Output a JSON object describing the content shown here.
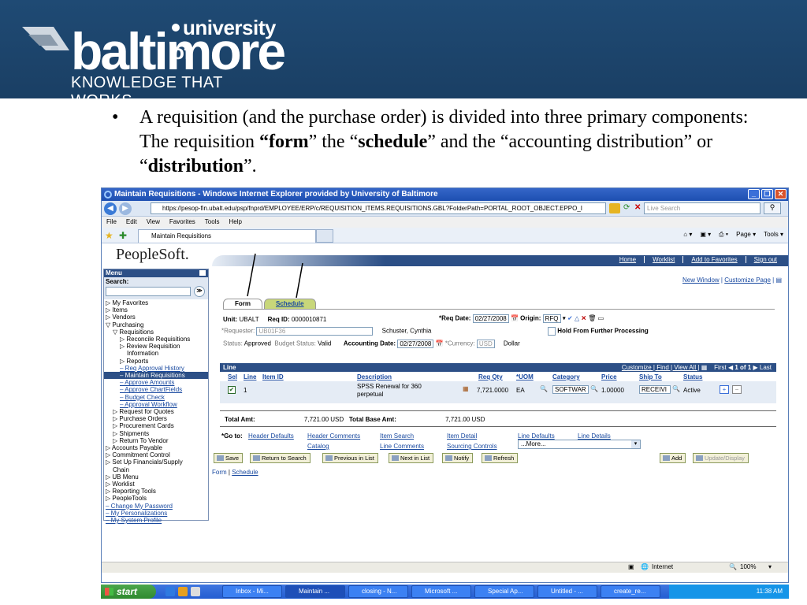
{
  "slide": {
    "logo": {
      "top": "university of",
      "main": "baltimore",
      "tagline": "KNOWLEDGE THAT WORKS"
    },
    "bullet": {
      "part1": "A requisition (and the purchase order) is divided into three primary components:  The requisition ",
      "form": "“form",
      "part2": "” the “",
      "schedule": "schedule",
      "part3": "” and the “accounting distribution” or “",
      "distribution": "distribution",
      "part4": "”."
    }
  },
  "browser": {
    "title": "Maintain Requisitions - Windows Internet Explorer provided by University of Baltimore",
    "url": "https://pesop-fin.ubalt.edu/psp/fnprd/EMPLOYEE/ERP/c/REQUISITION_ITEMS.REQUISITIONS.GBL?FolderPath=PORTAL_ROOT_OBJECT.EPPO_I",
    "search_placeholder": "Live Search",
    "menu": [
      "File",
      "Edit",
      "View",
      "Favorites",
      "Tools",
      "Help"
    ],
    "tab_label": "Maintain Requisitions",
    "commands": [
      "Page ▾",
      "Tools ▾"
    ],
    "status_zone": "Internet",
    "zoom": "100%"
  },
  "ps": {
    "logo": "PeopleSoft.",
    "links": [
      "Home",
      "Worklist",
      "Add to Favorites",
      "Sign out"
    ],
    "new_window": "New Window",
    "customize_page": "Customize Page",
    "menu_title": "Menu",
    "search_label": "Search:",
    "menu_items": [
      {
        "t": "▷ My Favorites",
        "i": 0
      },
      {
        "t": "▷ Items",
        "i": 0
      },
      {
        "t": "▷ Vendors",
        "i": 0
      },
      {
        "t": "▽ Purchasing",
        "i": 0
      },
      {
        "t": "▽ Requisitions",
        "i": 1
      },
      {
        "t": "▷ Reconcile Requisitions",
        "i": 2
      },
      {
        "t": "▷ Review Requisition",
        "i": 2
      },
      {
        "t": "Information",
        "i": 3
      },
      {
        "t": "▷ Reports",
        "i": 2
      },
      {
        "t": "– Req Approval History",
        "i": 2,
        "link": true
      },
      {
        "t": "– Maintain Requisitions",
        "i": 2,
        "sel": true
      },
      {
        "t": "– Approve Amounts",
        "i": 2,
        "link": true
      },
      {
        "t": "– Approve ChartFields",
        "i": 2,
        "link": true
      },
      {
        "t": "– Budget Check",
        "i": 2,
        "link": true
      },
      {
        "t": "– Approval Workflow",
        "i": 2,
        "link": true
      },
      {
        "t": "▷ Request for Quotes",
        "i": 1
      },
      {
        "t": "▷ Purchase Orders",
        "i": 1
      },
      {
        "t": "▷ Procurement Cards",
        "i": 1
      },
      {
        "t": "▷ Shipments",
        "i": 1
      },
      {
        "t": "▷ Return To Vendor",
        "i": 1
      },
      {
        "t": "▷ Accounts Payable",
        "i": 0
      },
      {
        "t": "▷ Commitment Control",
        "i": 0
      },
      {
        "t": "▷ Set Up Financials/Supply",
        "i": 0
      },
      {
        "t": "Chain",
        "i": 1
      },
      {
        "t": "▷ UB Menu",
        "i": 0
      },
      {
        "t": "▷ Worklist",
        "i": 0
      },
      {
        "t": "▷ Reporting Tools",
        "i": 0
      },
      {
        "t": "▷ PeopleTools",
        "i": 0
      },
      {
        "t": "– Change My Password",
        "i": 0,
        "link": true
      },
      {
        "t": "– My Personalizations",
        "i": 0,
        "link": true
      },
      {
        "t": "– My System Profile",
        "i": 0,
        "link": true
      }
    ],
    "tabs": {
      "form": "Form",
      "schedule": "Schedule"
    },
    "header": {
      "unit_label": "Unit:",
      "unit": "UBALT",
      "reqid_label": "Req ID:",
      "reqid": "0000010871",
      "reqdate_label": "*Req Date:",
      "reqdate": "02/27/2008",
      "origin_label": "Origin:",
      "origin": "RFQ",
      "requester_label": "*Requester:",
      "requester": "UB01F36",
      "requester_name": "Schuster, Cynthia",
      "hold_label": "Hold From Further Processing",
      "status_label": "Status:",
      "status": "Approved",
      "budget_label": "Budget Status:",
      "budget": "Valid",
      "acctdate_label": "Accounting Date:",
      "acctdate": "02/27/2008",
      "currency_label": "*Currency:",
      "currency": "USD",
      "currency_desc": "Dollar"
    },
    "grid": {
      "title": "Line",
      "nav": "Customize | Find | View All |",
      "pager": "First",
      "pager_count": "1 of 1",
      "pager_last": "Last",
      "columns": [
        "Sel",
        "Line",
        "Item ID",
        "Description",
        "Req Qty",
        "*UOM",
        "Category",
        "Price",
        "Ship To",
        "Status"
      ],
      "row": {
        "line": "1",
        "desc1": "SPSS Renewal for 360",
        "desc2": "perpetual",
        "qty": "7,721.0000",
        "uom": "EA",
        "category": "SOFTWAR",
        "price": "1.00000",
        "shipto": "RECEIVI",
        "status": "Active"
      }
    },
    "totals": {
      "amt_label": "Total Amt:",
      "amt": "7,721.00",
      "cur": "USD",
      "base_label": "Total Base Amt:",
      "base": "7,721.00",
      "base_cur": "USD"
    },
    "goto": {
      "label": "*Go to:",
      "links_row1": [
        "Header Defaults",
        "Header Comments",
        "Item Search",
        "Item Detail",
        "Line Defaults",
        "Line Details"
      ],
      "links_row2": [
        "Catalog",
        "Line Comments",
        "Sourcing Controls"
      ],
      "more": "...More..."
    },
    "buttons": [
      "Save",
      "Return to Search",
      "Previous in List",
      "Next in List",
      "Notify",
      "Refresh",
      "Add",
      "Update/Display"
    ],
    "footer_links": [
      "Form",
      "Schedule"
    ]
  },
  "taskbar": {
    "start": "start",
    "items": [
      "Inbox - Mi...",
      "Maintain ...",
      "closing - N...",
      "Microsoft ...",
      "Special Ap...",
      "Untitled - ...",
      "create_re..."
    ],
    "clock": "11:38 AM"
  }
}
